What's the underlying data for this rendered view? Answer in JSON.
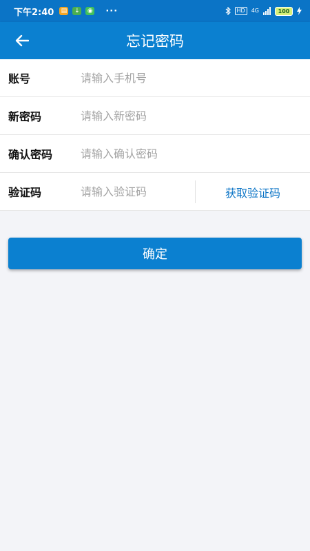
{
  "status_bar": {
    "time": "下午2:40",
    "dots": "···",
    "hd": "HD",
    "network": "4G",
    "battery": "100"
  },
  "header": {
    "title": "忘记密码",
    "back_icon": "arrow-left-icon"
  },
  "form": {
    "account": {
      "label": "账号",
      "placeholder": "请输入手机号"
    },
    "new_password": {
      "label": "新密码",
      "placeholder": "请输入新密码"
    },
    "confirm_password": {
      "label": "确认密码",
      "placeholder": "请输入确认密码"
    },
    "verification": {
      "label": "验证码",
      "placeholder": "请输入验证码",
      "get_code_label": "获取验证码"
    }
  },
  "confirm_button": {
    "label": "确定"
  },
  "colors": {
    "primary": "#0b80d0",
    "link": "#0b74c6",
    "background": "#f3f4f8"
  }
}
